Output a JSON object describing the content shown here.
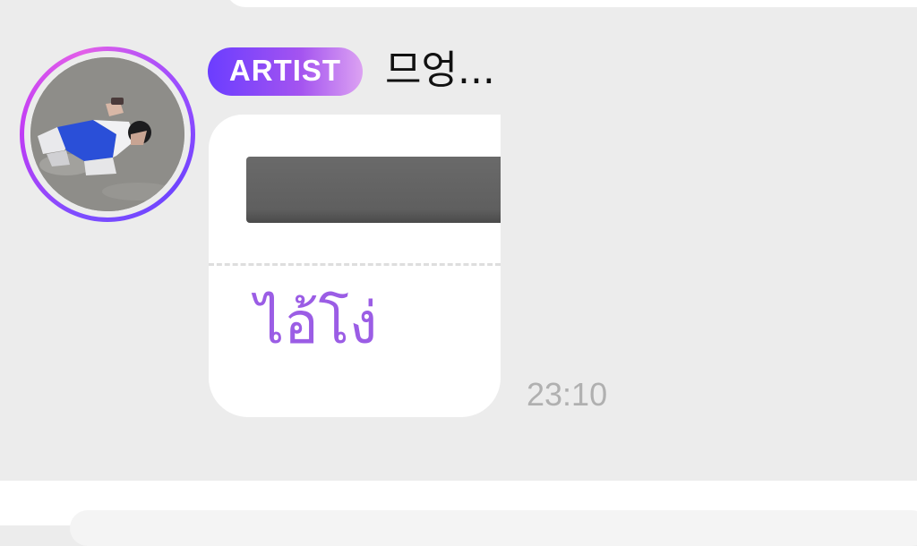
{
  "message": {
    "badge_label": "ARTIST",
    "sender_name": "므엉...",
    "text": "ไอ้โง่",
    "timestamp": "23:10"
  },
  "colors": {
    "badge_start": "#6b3dff",
    "badge_end": "#dca2f2",
    "message_text": "#9b5de5",
    "timestamp": "#b0b0b0",
    "background": "#ececec",
    "bubble": "#ffffff"
  },
  "icons": {
    "avatar": "profile-photo-person-lying-on-ground"
  }
}
